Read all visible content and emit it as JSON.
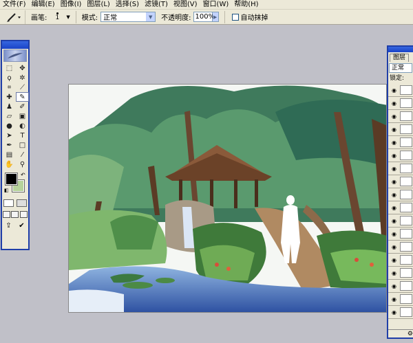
{
  "menu": [
    {
      "label": "文件(F)"
    },
    {
      "label": "编辑(E)"
    },
    {
      "label": "图像(I)"
    },
    {
      "label": "图层(L)"
    },
    {
      "label": "选择(S)"
    },
    {
      "label": "滤镜(T)"
    },
    {
      "label": "视图(V)"
    },
    {
      "label": "窗口(W)"
    },
    {
      "label": "帮助(H)"
    }
  ],
  "options": {
    "brush_label": "画笔:",
    "brush_size": "1",
    "mode_label": "模式:",
    "mode_value": "正常",
    "opacity_label": "不透明度:",
    "opacity_value": "100%",
    "auto_erase_label": "自动抹掉"
  },
  "toolbox": {
    "tools": [
      {
        "name": "marquee-tool",
        "glyph": "⬚"
      },
      {
        "name": "move-tool",
        "glyph": "✥"
      },
      {
        "name": "lasso-tool",
        "glyph": "ϙ"
      },
      {
        "name": "magic-wand-tool",
        "glyph": "✲"
      },
      {
        "name": "crop-tool",
        "glyph": "⌗"
      },
      {
        "name": "slice-tool",
        "glyph": "⟋"
      },
      {
        "name": "healing-brush-tool",
        "glyph": "✚"
      },
      {
        "name": "pencil-tool",
        "glyph": "✎"
      },
      {
        "name": "clone-stamp-tool",
        "glyph": "♟"
      },
      {
        "name": "history-brush-tool",
        "glyph": "✐"
      },
      {
        "name": "eraser-tool",
        "glyph": "▱"
      },
      {
        "name": "gradient-tool",
        "glyph": "▣"
      },
      {
        "name": "blur-tool",
        "glyph": "●"
      },
      {
        "name": "dodge-tool",
        "glyph": "◐"
      },
      {
        "name": "path-selection-tool",
        "glyph": "➤"
      },
      {
        "name": "type-tool",
        "glyph": "T"
      },
      {
        "name": "pen-tool",
        "glyph": "✒"
      },
      {
        "name": "shape-tool",
        "glyph": "□"
      },
      {
        "name": "notes-tool",
        "glyph": "▤"
      },
      {
        "name": "eyedropper-tool",
        "glyph": "⁄"
      },
      {
        "name": "hand-tool",
        "glyph": "✋"
      },
      {
        "name": "zoom-tool",
        "glyph": "⚲"
      }
    ],
    "active_tool": "pencil-tool",
    "foreground_color": "#000000",
    "background_color": "#b6d39b"
  },
  "layers": {
    "tab_label": "图层",
    "blend_mode": "正常",
    "lock_label": "锁定:",
    "layer_count": 18
  },
  "colors": {
    "accent": "#1f3ea8",
    "chrome": "#ece9d8",
    "workspace": "#c0c0c8"
  }
}
